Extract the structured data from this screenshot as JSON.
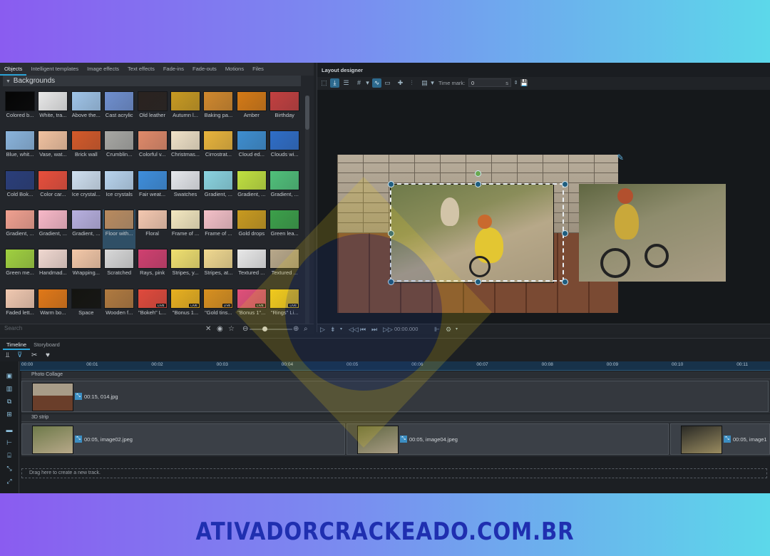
{
  "objects_panel": {
    "tabs": [
      "Objects",
      "Intelligent templates",
      "Image effects",
      "Text effects",
      "Fade-ins",
      "Fade-outs",
      "Motions",
      "Files"
    ],
    "group_title": "Backgrounds",
    "search_placeholder": "Search",
    "items": [
      {
        "label": "Colored b...",
        "color": "#050505"
      },
      {
        "label": "White, tra...",
        "color": "#e8e8e8"
      },
      {
        "label": "Above the...",
        "color": "#9fc4e8"
      },
      {
        "label": "Cast acrylic",
        "color": "#6f8fcf"
      },
      {
        "label": "Old leather",
        "color": "#2a2320"
      },
      {
        "label": "Autumn l...",
        "color": "#c89a22"
      },
      {
        "label": "Baking pa...",
        "color": "#d0882d"
      },
      {
        "label": "Amber",
        "color": "#d47a16"
      },
      {
        "label": "Birthday",
        "color": "#c24040"
      },
      {
        "label": "Blue, whit...",
        "color": "#8ab4dc"
      },
      {
        "label": "Vase, wat...",
        "color": "#f1c2a0"
      },
      {
        "label": "Brick wall",
        "color": "#d45a2a"
      },
      {
        "label": "Crumblin...",
        "color": "#a8a8a4"
      },
      {
        "label": "Colorful v...",
        "color": "#e08a6a"
      },
      {
        "label": "Christmas...",
        "color": "#f0e2c8"
      },
      {
        "label": "Cirrostrat...",
        "color": "#e8b43c"
      },
      {
        "label": "Cloud ed...",
        "color": "#3e8ed0"
      },
      {
        "label": "Clouds wi...",
        "color": "#2f6ec8"
      },
      {
        "label": "Cold Bok...",
        "color": "#2a3e7a"
      },
      {
        "label": "Color car...",
        "color": "#e84f3c"
      },
      {
        "label": "Ice crystal...",
        "color": "#cfe0f0"
      },
      {
        "label": "Ice crystals",
        "color": "#b8d4ee"
      },
      {
        "label": "Fair weat...",
        "color": "#3e8edc"
      },
      {
        "label": "Swatches",
        "color": "#e6e8ec"
      },
      {
        "label": "Gradient, ...",
        "color": "#8ad4e0"
      },
      {
        "label": "Gradient, ...",
        "color": "#c0e040"
      },
      {
        "label": "Gradient, ...",
        "color": "#50c07a"
      },
      {
        "label": "Gradient, ...",
        "color": "#f0a090"
      },
      {
        "label": "Gradient, ...",
        "color": "#f8b8c8"
      },
      {
        "label": "Gradient, ...",
        "color": "#b8b0e0"
      },
      {
        "label": "Floor with...",
        "color": "#b98a5e"
      },
      {
        "label": "Floral",
        "color": "#f4c8b0"
      },
      {
        "label": "Frame of ...",
        "color": "#f4e8c0"
      },
      {
        "label": "Frame of ...",
        "color": "#f4c0c8"
      },
      {
        "label": "Gold drops",
        "color": "#c89a20"
      },
      {
        "label": "Green lea...",
        "color": "#3ca04a"
      },
      {
        "label": "Green me...",
        "color": "#a0d040"
      },
      {
        "label": "Handmad...",
        "color": "#f0d8d0"
      },
      {
        "label": "Wrapping...",
        "color": "#f4c8a8"
      },
      {
        "label": "Scratched",
        "color": "#d8d8d8"
      },
      {
        "label": "Rays, pink",
        "color": "#d04070"
      },
      {
        "label": "Stripes, y...",
        "color": "#f0e070"
      },
      {
        "label": "Stripes, at...",
        "color": "#f0d890"
      },
      {
        "label": "Textured ...",
        "color": "#e8e8e8"
      },
      {
        "label": "Textured ...",
        "color": "#b8a88a"
      },
      {
        "label": "Faded lett...",
        "color": "#f0c8b0"
      },
      {
        "label": "Warm bo...",
        "color": "#e07818"
      },
      {
        "label": "Space",
        "color": "#141410"
      },
      {
        "label": "Wooden f...",
        "color": "#b07a40"
      },
      {
        "label": "\"Bokeh\" L...",
        "color": "#e04a3c",
        "live": true
      },
      {
        "label": "\"Bonus 1...",
        "color": "#e8b020",
        "live": true
      },
      {
        "label": "\"Gold tins...",
        "color": "#d89020",
        "live": true
      },
      {
        "label": "\"Bonus 1\"...",
        "color": "#e0507a",
        "live": true
      },
      {
        "label": "\"Rings\" Li...",
        "color": "#f0c820",
        "live": true
      }
    ],
    "live_label": "LIVE"
  },
  "designer": {
    "title": "Layout designer",
    "time_mark_label": "Time mark:",
    "time_mark_value": "0",
    "time_mark_unit": "s",
    "transport_time": "00:00.000"
  },
  "timeline": {
    "tabs": [
      "Timeline",
      "Storyboard"
    ],
    "ruler": [
      "00:00",
      "00:01",
      "00:02",
      "00:03",
      "00:04",
      "00:05",
      "00:06",
      "00:07",
      "00:08",
      "00:09",
      "00:10",
      "00:11"
    ],
    "tracks": [
      {
        "name": "Photo Collage",
        "clips": [
          {
            "label": "00:15, 014.jpg"
          }
        ]
      },
      {
        "name": "3D strip",
        "clips": [
          {
            "label": "00:05, image02.jpeg"
          },
          {
            "label": "00:05, image04.jpeg"
          },
          {
            "label": "00:05, image1"
          }
        ]
      }
    ],
    "drag_hint": "Drag here to create a new track."
  },
  "watermark": "ATIVADORCRACKEADO.COM.BR"
}
